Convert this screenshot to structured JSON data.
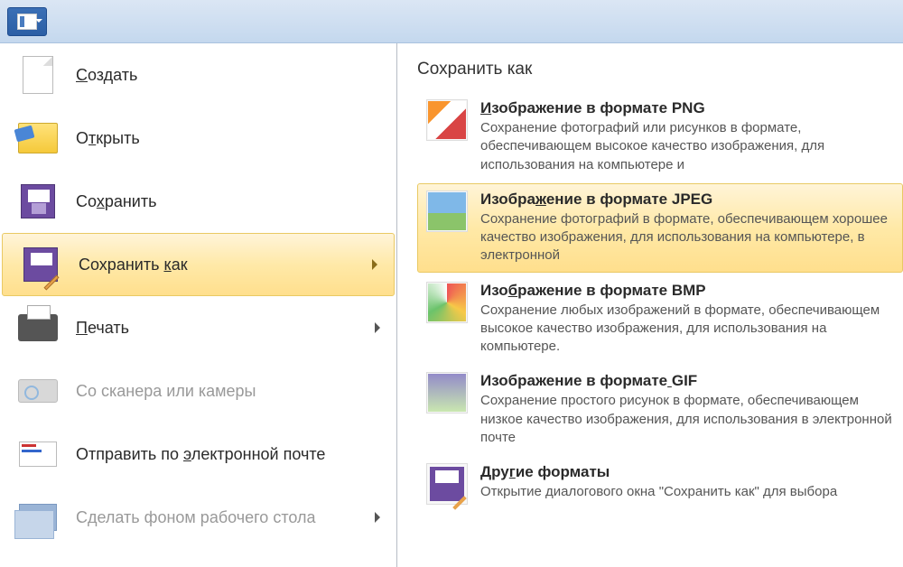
{
  "menu": {
    "items": [
      {
        "label": "Создать",
        "accel_index": 0,
        "disabled": false,
        "has_arrow": false,
        "icon": "new"
      },
      {
        "label": "Открыть",
        "accel_index": 1,
        "disabled": false,
        "has_arrow": false,
        "icon": "open"
      },
      {
        "label": "Сохранить",
        "accel_index": 2,
        "disabled": false,
        "has_arrow": false,
        "icon": "save"
      },
      {
        "label": "Сохранить как",
        "accel_index": 10,
        "disabled": false,
        "has_arrow": true,
        "selected": true,
        "icon": "saveas"
      },
      {
        "label": "Печать",
        "accel_index": 0,
        "disabled": false,
        "has_arrow": true,
        "icon": "print"
      },
      {
        "label": "Со сканера или камеры",
        "accel_index": -1,
        "disabled": true,
        "has_arrow": false,
        "icon": "scanner"
      },
      {
        "label": "Отправить по электронной почте",
        "accel_index": 13,
        "disabled": false,
        "has_arrow": false,
        "icon": "email"
      },
      {
        "label": "Сделать фоном рабочего стола",
        "accel_index": -1,
        "disabled": true,
        "has_arrow": true,
        "icon": "wall"
      }
    ]
  },
  "submenu": {
    "title": "Сохранить как",
    "items": [
      {
        "title": "Изображение в формате PNG",
        "accel_index": 0,
        "desc": "Сохранение фотографий или рисунков в формате, обеспечивающем высокое качество изображения, для использования на компьютере и",
        "icon": "png"
      },
      {
        "title": "Изображение в формате JPEG",
        "accel_index": 6,
        "desc": "Сохранение фотографий в формате, обеспечивающем хорошее качество изображения, для использования на компьютере, в электронной",
        "icon": "jpeg",
        "highlighted": true
      },
      {
        "title": "Изображение в формате BMP",
        "accel_index": 3,
        "desc": "Сохранение любых изображений в формате, обеспечивающем высокое качество изображения, для использования на компьютере.",
        "icon": "bmp"
      },
      {
        "title": "Изображение в формате GIF",
        "accel_index": 21,
        "desc": "Сохранение простого рисунок в формате, обеспечивающем низкое качество изображения, для использования в электронной почте",
        "icon": "gif"
      },
      {
        "title": "Другие форматы",
        "accel_index": 3,
        "desc": "Открытие диалогового окна \"Сохранить как\" для выбора",
        "icon": "other"
      }
    ]
  }
}
